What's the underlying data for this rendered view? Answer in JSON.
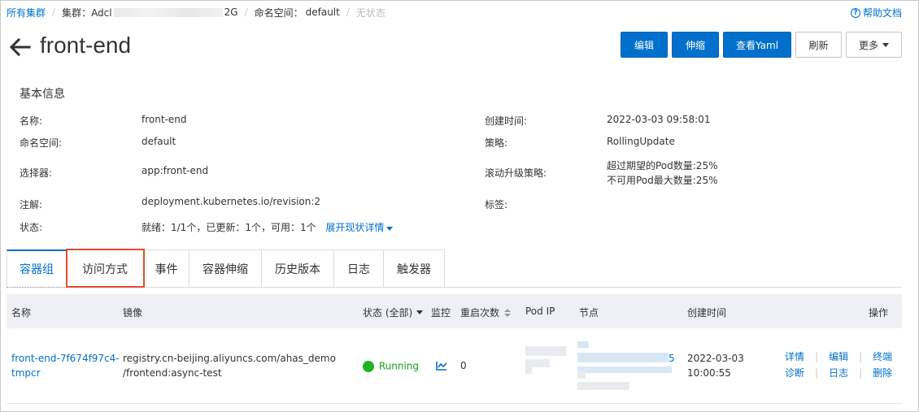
{
  "breadcrumb": {
    "all_clusters": "所有集群",
    "cluster_label": "集群：Adcl",
    "cluster_suffix": "2G",
    "namespace_label": "命名空间：",
    "namespace_value": "default",
    "status": "无状态"
  },
  "help": {
    "icon": "question-circle-icon",
    "label": "帮助文档"
  },
  "header": {
    "title": "front-end"
  },
  "toolbar": {
    "edit": "编辑",
    "scale": "伸缩",
    "view_yaml": "查看Yaml",
    "refresh": "刷新",
    "more": "更多"
  },
  "basic_info": {
    "title": "基本信息",
    "name_label": "名称:",
    "name_value": "front-end",
    "namespace_label": "命名空间:",
    "namespace_value": "default",
    "selector_label": "选择器:",
    "selector_value": "app:front-end",
    "annotation_label": "注解:",
    "annotation_value": "deployment.kubernetes.io/revision:2",
    "status_label": "状态:",
    "status_value": "就绪：1/1个，已更新：1个，可用：1个",
    "status_link": "展开现状详情",
    "created_label": "创建时间:",
    "created_value": "2022-03-03 09:58:01",
    "strategy_label": "策略:",
    "strategy_value": "RollingUpdate",
    "rolling_label": "滚动升级策略:",
    "rolling_value_1": "超过期望的Pod数量:25%",
    "rolling_value_2": "不可用Pod最大数量:25%",
    "tags_label": "标签:"
  },
  "tabs": [
    "容器组",
    "访问方式",
    "事件",
    "容器伸缩",
    "历史版本",
    "日志",
    "触发器"
  ],
  "table": {
    "headers": {
      "name": "名称",
      "image": "镜像",
      "status": "状态 (全部)",
      "monitor": "监控",
      "restarts": "重启次数",
      "pod_ip": "Pod IP",
      "node": "节点",
      "created": "创建时间",
      "actions": "操作"
    },
    "rows": [
      {
        "name_1": "front-end-7f674f97c4-",
        "name_2": "tmpcr",
        "image_1": "registry.cn-beijing.aliyuncs.com/ahas_demo",
        "image_2": "/frontend:async-test",
        "status": "Running",
        "restarts": "0",
        "node_suffix": "5",
        "created_1": "2022-03-03",
        "created_2": "10:00:55",
        "actions": {
          "detail": "详情",
          "edit": "编辑",
          "terminal": "终端",
          "diagnose": "诊断",
          "log": "日志",
          "delete": "删除"
        }
      }
    ]
  },
  "colors": {
    "primary": "#0070cc",
    "running": "#1fb41f",
    "highlight": "#e44d2e"
  }
}
